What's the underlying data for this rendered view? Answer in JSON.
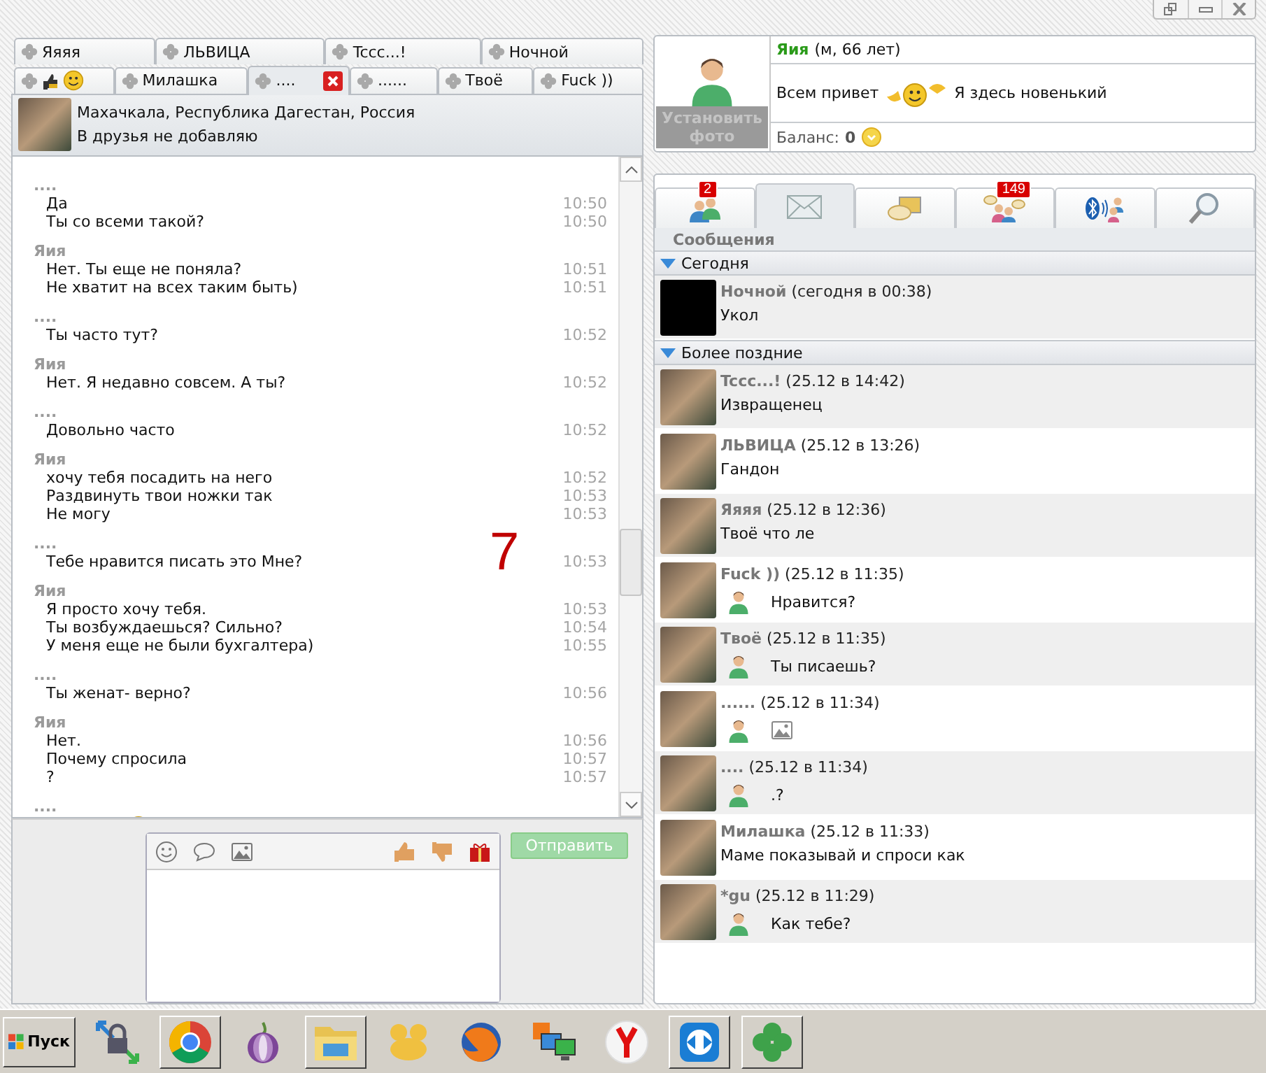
{
  "chat_tabs": [
    [
      {
        "kind": "text",
        "label": "Яяяя",
        "selected": false
      },
      {
        "kind": "text",
        "label": "ЛЬВИЦА",
        "selected": false
      },
      {
        "kind": "text",
        "label": "Tccc...!",
        "selected": false
      },
      {
        "kind": "text",
        "label": "Ночной",
        "selected": false
      }
    ],
    [
      {
        "kind": "icons",
        "selected": false
      },
      {
        "kind": "text",
        "label": "Милашка",
        "selected": false
      },
      {
        "kind": "text",
        "label": "....",
        "selected": true
      },
      {
        "kind": "text",
        "label": "......",
        "selected": false
      },
      {
        "kind": "text",
        "label": "Твоё",
        "selected": false
      },
      {
        "kind": "text",
        "label": "Fuck ))",
        "selected": false
      }
    ]
  ],
  "contact": {
    "location": "Махачкала, Республика Дагестан, Россия",
    "status": "В друзья не добавляю"
  },
  "chat": {
    "groups": [
      {
        "sender": "....",
        "kind": "text",
        "lines": [
          {
            "text": "Да",
            "time": "10:50"
          },
          {
            "text": "Ты со всеми такой?",
            "time": "10:50"
          }
        ]
      },
      {
        "sender": "Яия",
        "kind": "text",
        "lines": [
          {
            "text": "Нет. Ты еще не поняла?",
            "time": "10:51"
          },
          {
            "text": "Не хватит на всех таким быть)",
            "time": "10:51"
          }
        ]
      },
      {
        "sender": "....",
        "kind": "text",
        "lines": [
          {
            "text": "Ты часто тут?",
            "time": "10:52"
          }
        ]
      },
      {
        "sender": "Яия",
        "kind": "text",
        "lines": [
          {
            "text": "Нет. Я недавно совсем. А ты?",
            "time": "10:52"
          }
        ]
      },
      {
        "sender": "....",
        "kind": "text",
        "lines": [
          {
            "text": "Довольно часто",
            "time": "10:52"
          }
        ]
      },
      {
        "sender": "Яия",
        "kind": "text",
        "lines": [
          {
            "text": "хочу тебя посадить на него",
            "time": "10:52"
          },
          {
            "text": "Раздвинуть твои ножки так",
            "time": "10:53"
          },
          {
            "text": "Не могу",
            "time": "10:53"
          }
        ]
      },
      {
        "sender": "....",
        "kind": "text",
        "lines": [
          {
            "text": "Тебе нравится писать это Мне?",
            "time": "10:53"
          }
        ]
      },
      {
        "sender": "Яия",
        "kind": "text",
        "lines": [
          {
            "text": "Я просто хочу тебя.",
            "time": "10:53"
          },
          {
            "text": "Ты возбуждаешься? Сильно?",
            "time": "10:54"
          },
          {
            "text": "У меня еще не были бухгалтера)",
            "time": "10:55"
          }
        ]
      },
      {
        "sender": "....",
        "kind": "text",
        "lines": [
          {
            "text": "Ты женат- верно?",
            "time": "10:56"
          }
        ]
      },
      {
        "sender": "Яия",
        "kind": "text",
        "lines": [
          {
            "text": "Нет.",
            "time": "10:56"
          },
          {
            "text": "Почему спросила",
            "time": "10:57"
          },
          {
            "text": "?",
            "time": "10:57"
          }
        ]
      },
      {
        "sender": "....",
        "kind": "emoji"
      }
    ],
    "annotation": "7"
  },
  "composer": {
    "send_button": "Отправить",
    "send_disabled": true
  },
  "profile": {
    "photo_label": "Установить фото",
    "name": "Яия",
    "details": "(м, 66 лет)",
    "status_before": "Всем привет",
    "status_after": "Я здесь новенький",
    "balance_label": "Баланс:",
    "balance": "0"
  },
  "nav_tabs": [
    {
      "kind": "contacts",
      "badge": "2",
      "selected": false
    },
    {
      "kind": "mail",
      "selected": true
    },
    {
      "kind": "chat",
      "selected": false
    },
    {
      "kind": "groups",
      "badge": "149",
      "selected": false
    },
    {
      "kind": "bluetooth",
      "selected": false
    },
    {
      "kind": "search",
      "selected": false
    }
  ],
  "messages": {
    "title": "Сообщения",
    "sections": [
      {
        "title": "Сегодня",
        "expanded": true,
        "items": [
          {
            "name": "Ночной",
            "when": "(сегодня в 00:38)",
            "kind": "text",
            "text": "Укол",
            "has_photo": false
          }
        ]
      },
      {
        "title": "Более поздние",
        "expanded": true,
        "items": [
          {
            "name": "Tccc...!",
            "when": "(25.12 в 14:42)",
            "kind": "text",
            "text": "Извращенец",
            "has_photo": true
          },
          {
            "name": "ЛЬВИЦА",
            "when": "(25.12 в 13:26)",
            "kind": "text",
            "text": "Гандон",
            "has_photo": true
          },
          {
            "name": "Яяяя",
            "when": "(25.12 в 12:36)",
            "kind": "text",
            "text": "Твоё что ле",
            "has_photo": true
          },
          {
            "name": "Fuck ))",
            "when": "(25.12 в 11:35)",
            "kind": "reply",
            "text": "Нравится?",
            "has_photo": true
          },
          {
            "name": "Твоё",
            "when": "(25.12 в 11:35)",
            "kind": "reply",
            "text": "Ты писаешь?",
            "has_photo": true
          },
          {
            "name": "......",
            "when": "(25.12 в 11:34)",
            "kind": "image",
            "has_photo": true
          },
          {
            "name": "....",
            "when": "(25.12 в 11:34)",
            "kind": "reply",
            "text": ".?",
            "has_photo": true
          },
          {
            "name": "Милашка",
            "when": "(25.12 в 11:33)",
            "kind": "text",
            "text": "Маме показывай и спроси как",
            "has_photo": true
          },
          {
            "name": "*gu",
            "when": "(25.12 в 11:29)",
            "kind": "reply",
            "text": "Как тебе?",
            "has_photo": true
          }
        ]
      }
    ]
  },
  "taskbar": {
    "start": "Пуск",
    "apps": [
      {
        "kind": "lock",
        "open": false
      },
      {
        "kind": "circle",
        "open": true
      },
      {
        "kind": "onion",
        "open": false
      },
      {
        "kind": "folder",
        "open": true
      },
      {
        "kind": "paw",
        "open": false
      },
      {
        "kind": "globe",
        "open": false
      },
      {
        "kind": "monitors",
        "open": false
      },
      {
        "kind": "yletter",
        "open": false
      },
      {
        "kind": "arrows",
        "open": true
      },
      {
        "kind": "clover",
        "open": true
      }
    ]
  }
}
